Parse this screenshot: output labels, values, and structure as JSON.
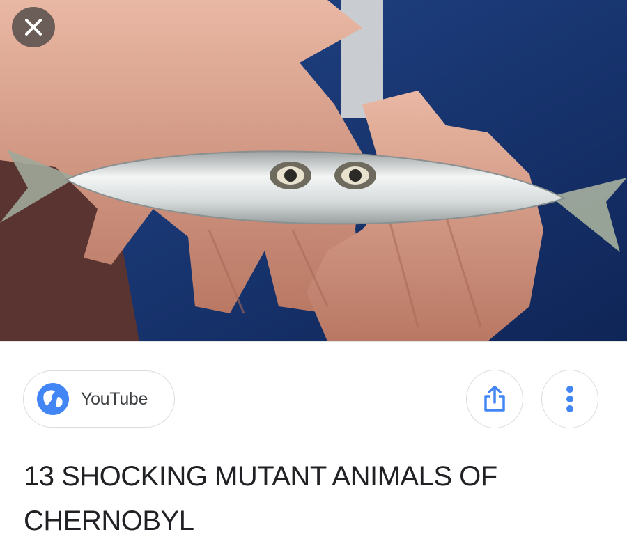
{
  "result": {
    "image_subject": "",
    "source": {
      "name": "YouTube",
      "icon": "globe-icon"
    },
    "title": "13 SHOCKING MUTANT ANIMALS OF CHERNOBYL"
  },
  "controls": {
    "close_icon": "close-icon",
    "share_icon": "share-icon",
    "more_icon": "more-vert-icon"
  },
  "colors": {
    "accent": "#4285f4",
    "border": "#dadce0",
    "title_text": "#202124",
    "overlay": "#3c3c3c"
  }
}
